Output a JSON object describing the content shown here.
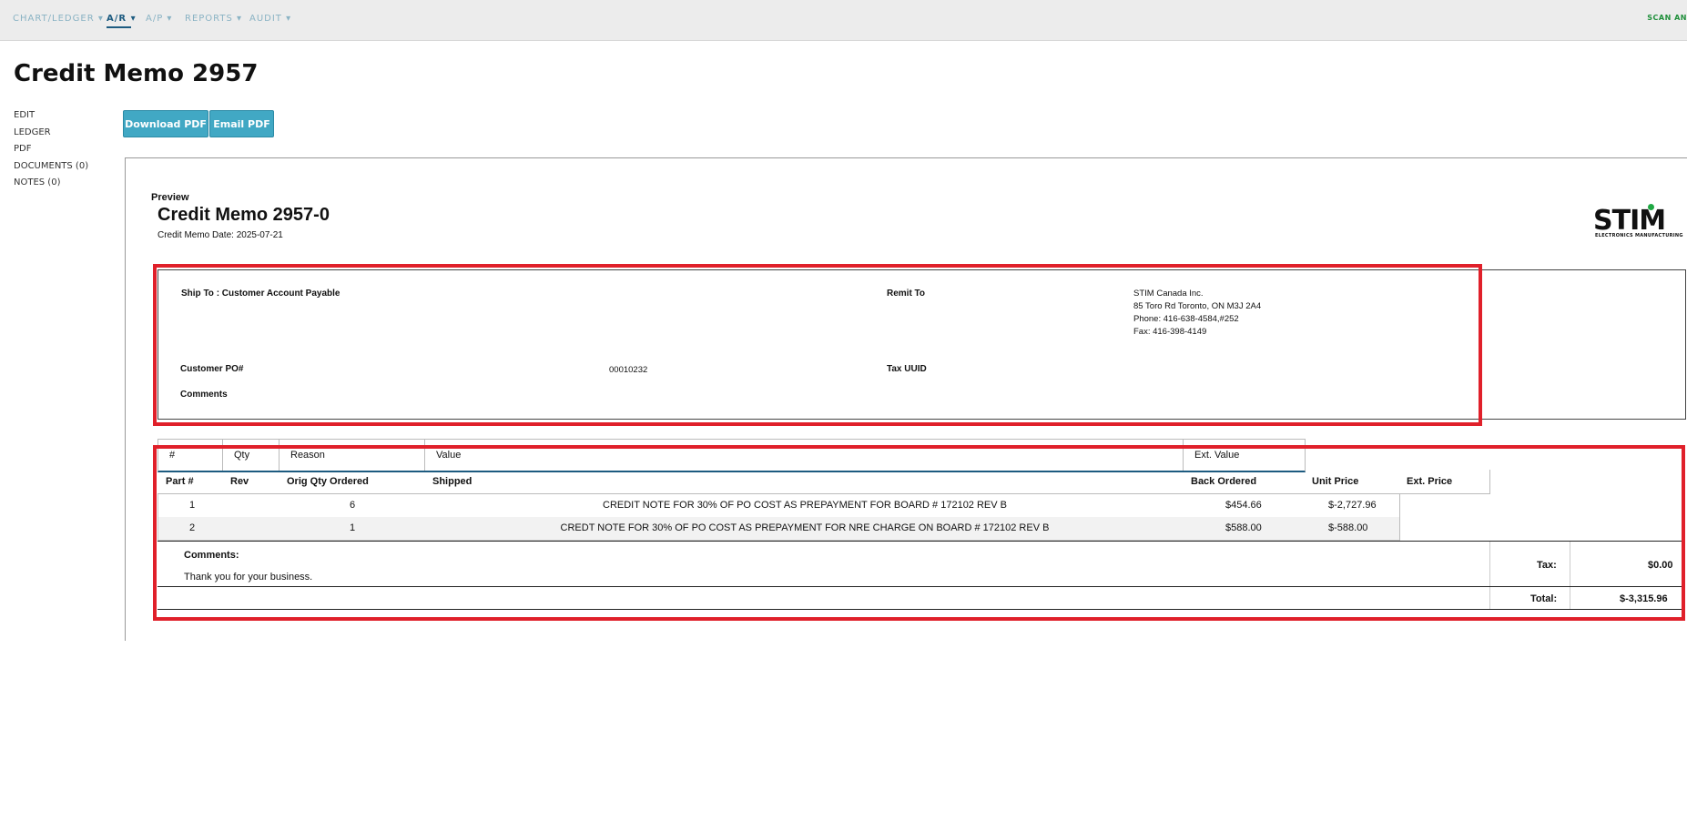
{
  "nav": {
    "items": [
      {
        "label": "CHART/LEDGER ▾"
      },
      {
        "label": "A/R ▾"
      },
      {
        "label": "A/P ▾"
      },
      {
        "label": "REPORTS ▾"
      },
      {
        "label": "AUDIT ▾"
      }
    ],
    "right_link": "SCAN AN"
  },
  "page_title": "Credit Memo 2957",
  "sidebar": {
    "items": [
      {
        "label": "EDIT"
      },
      {
        "label": "LEDGER"
      },
      {
        "label": "PDF"
      },
      {
        "label": "DOCUMENTS (0)"
      },
      {
        "label": "NOTES (0)"
      }
    ]
  },
  "actions": {
    "download": "Download PDF",
    "email": "Email PDF"
  },
  "preview": {
    "label": "Preview",
    "title": "Credit Memo 2957-0",
    "date": "Credit Memo Date: 2025-07-21",
    "logo_text": "STIM",
    "logo_sub": "ELECTRONICS MANUFACTURING"
  },
  "info": {
    "ship_to": "Ship To : Customer Account Payable",
    "remit_to_label": "Remit To",
    "remit_lines": [
      "STIM Canada Inc.",
      "85 Toro Rd Toronto, ON M3J 2A4",
      "Phone: 416-638-4584,#252",
      "Fax: 416-398-4149"
    ],
    "po_label": "Customer PO#",
    "po_value": "00010232",
    "tax_uuid_label": "Tax UUID",
    "comments_label": "Comments"
  },
  "reason_table": {
    "headers": [
      "#",
      "Qty",
      "Reason",
      "Value",
      "Ext. Value"
    ]
  },
  "items_table": {
    "headers": [
      "Part #",
      "Rev",
      "Orig Qty Ordered",
      "Shipped",
      "Back Ordered",
      "Unit Price",
      "Ext. Price"
    ],
    "rows": [
      {
        "part": "1",
        "qty": "6",
        "description": "CREDIT NOTE FOR 30% OF PO COST AS PREPAYMENT FOR BOARD # 172102 REV B",
        "unit_price": "$454.66",
        "ext_price": "$-2,727.96"
      },
      {
        "part": "2",
        "qty": "1",
        "description": "CREDT NOTE FOR 30% OF PO COST AS PREPAYMENT FOR NRE CHARGE ON BOARD # 172102 REV B",
        "unit_price": "$588.00",
        "ext_price": "$-588.00"
      }
    ]
  },
  "totals": {
    "comments_label": "Comments:",
    "comments_text": "Thank you for your business.",
    "tax_label": "Tax:",
    "tax_value": "$0.00",
    "total_label": "Total:",
    "total_value": "$-3,315.96"
  },
  "colors": {
    "nav_active": "#1d5b80",
    "nav_inactive": "#8ab3c4",
    "button": "#41a8c4",
    "highlight": "#e0202a",
    "logo_dot": "#1fa843"
  }
}
